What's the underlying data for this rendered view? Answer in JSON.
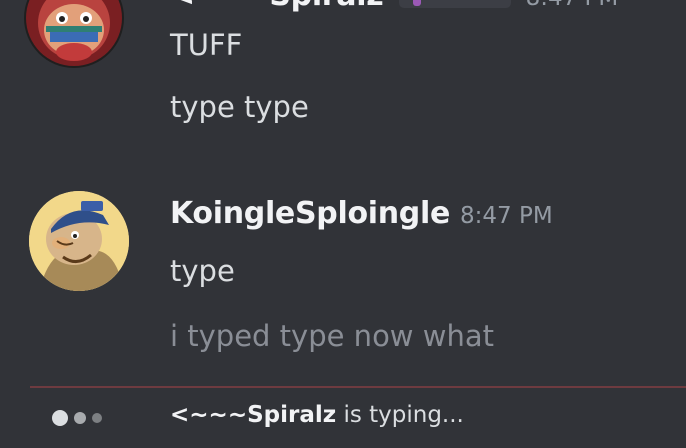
{
  "messages": [
    {
      "author": "<~~~Spiralz",
      "time": "8:47 PM",
      "avatar_icon": "muppet-avatar-icon",
      "lines": [
        "TUFF",
        "type type"
      ]
    },
    {
      "author": "KoingleSploingle",
      "time": "8:47 PM",
      "avatar_icon": "cartoon-character-avatar-icon",
      "lines": [
        "type",
        "i typed type now what"
      ]
    }
  ],
  "typing": {
    "name": "<~~~Spiralz",
    "suffix": " is typing..."
  },
  "colors": {
    "background": "#313338",
    "username": "#f2f3f5",
    "timestamp": "#949ba4",
    "message": "#dbdee1",
    "new_messages_divider": "#6e3b40"
  }
}
